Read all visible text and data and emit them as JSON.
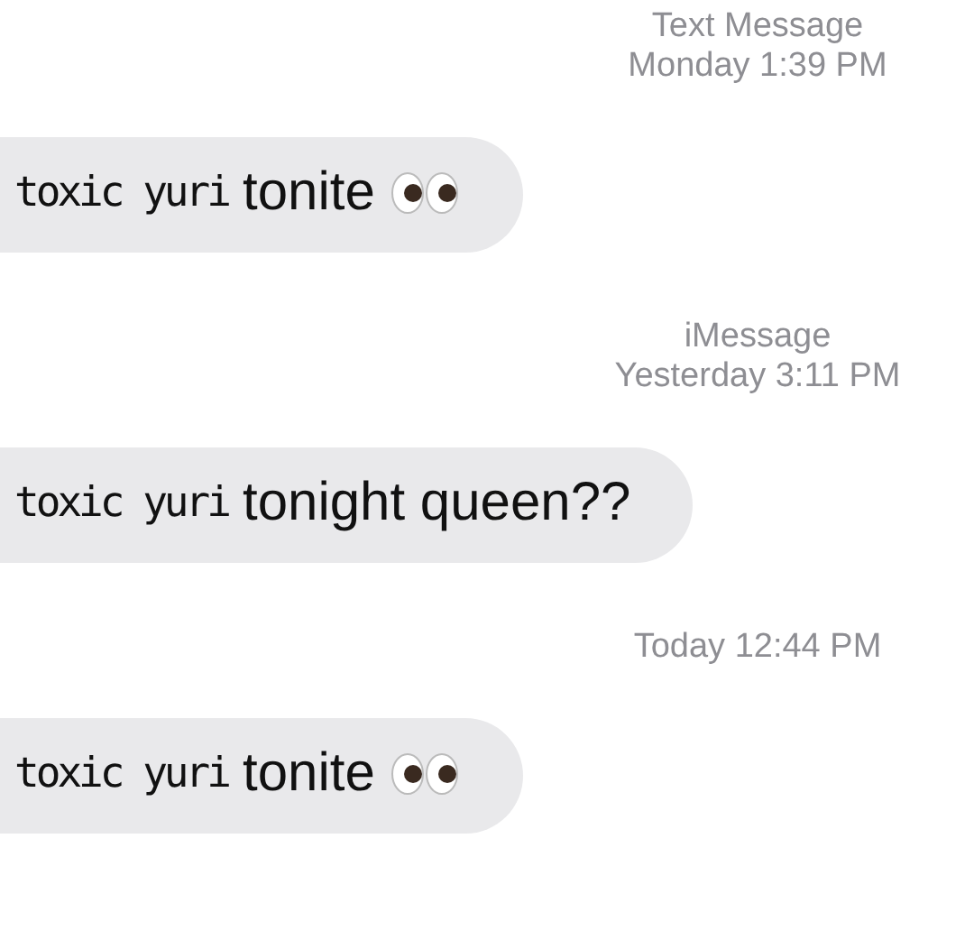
{
  "conversation": [
    {
      "kind": "timestamp",
      "service": "Text Message",
      "time": "Monday 1:39 PM"
    },
    {
      "kind": "message",
      "prefix": "toxic yuri",
      "text": "tonite",
      "emoji": true
    },
    {
      "kind": "timestamp",
      "service": "iMessage",
      "time": "Yesterday 3:11 PM"
    },
    {
      "kind": "message",
      "prefix": "toxic yuri",
      "text": "tonight queen??",
      "emoji": false
    },
    {
      "kind": "timestamp",
      "time": "Today 12:44 PM"
    },
    {
      "kind": "message",
      "prefix": "toxic yuri",
      "text": "tonite",
      "emoji": true
    }
  ]
}
